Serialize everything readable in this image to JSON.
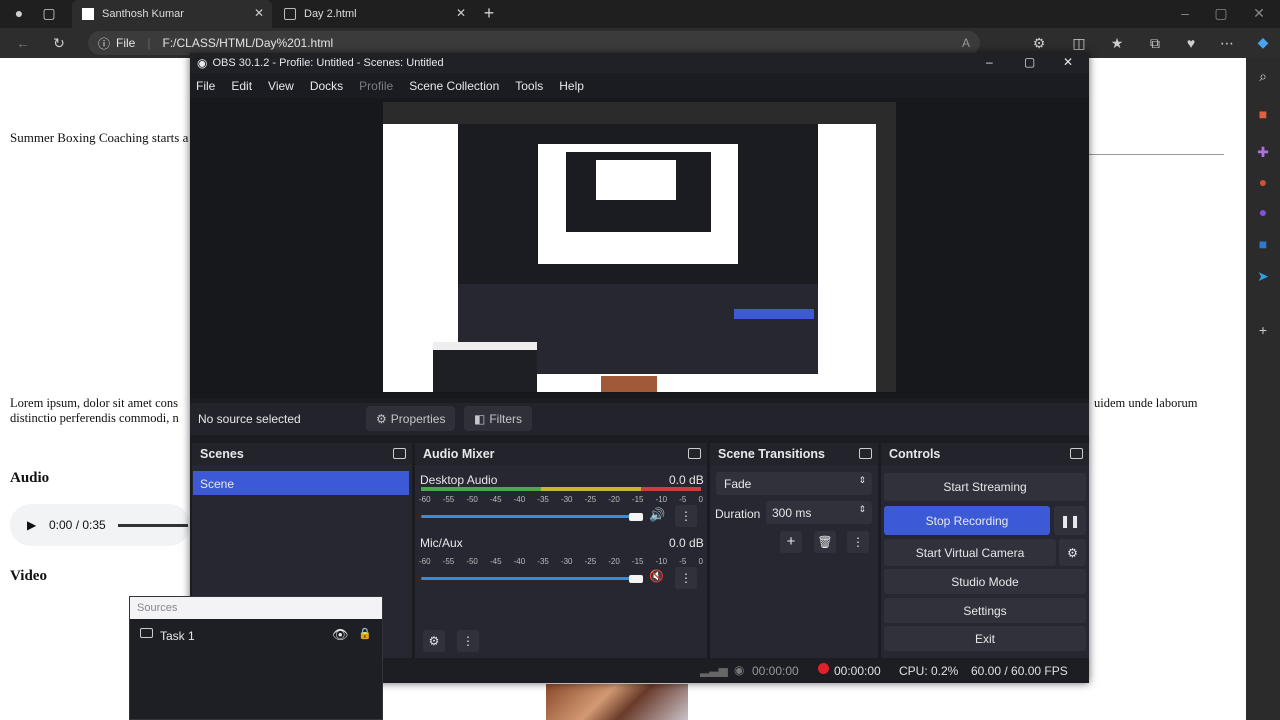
{
  "browser": {
    "tabs": [
      {
        "title": "Santhosh Kumar",
        "active": true
      },
      {
        "title": "Day 2.html",
        "active": false
      }
    ],
    "address": {
      "scheme_label": "File",
      "url": "F:/CLASS/HTML/Day%201.html"
    }
  },
  "webpage": {
    "headline": "Summer Boxing Coaching starts a",
    "lorem_left_1": "Lorem ipsum, dolor sit amet cons",
    "lorem_left_2": "distinctio perferendis commodi, n",
    "lorem_right": "uidem unde laborum",
    "audio_heading": "Audio",
    "audio_time": "0:00 / 0:35",
    "video_heading": "Video"
  },
  "obs": {
    "title": "OBS 30.1.2 - Profile: Untitled - Scenes: Untitled",
    "menu": [
      "File",
      "Edit",
      "View",
      "Docks",
      "Profile",
      "Scene Collection",
      "Tools",
      "Help"
    ],
    "menu_disabled": "Profile",
    "context_bar": {
      "no_source": "No source selected",
      "properties": "Properties",
      "filters": "Filters"
    },
    "scenes": {
      "title": "Scenes",
      "items": [
        "Scene"
      ]
    },
    "audio_mixer": {
      "title": "Audio Mixer",
      "channels": [
        {
          "name": "Desktop Audio",
          "level": "0.0 dB",
          "muted": false
        },
        {
          "name": "Mic/Aux",
          "level": "0.0 dB",
          "muted": true
        }
      ],
      "ticks": [
        "-60",
        "-55",
        "-50",
        "-45",
        "-40",
        "-35",
        "-30",
        "-25",
        "-20",
        "-15",
        "-10",
        "-5",
        "0"
      ]
    },
    "transitions": {
      "title": "Scene Transitions",
      "selected": "Fade",
      "duration_label": "Duration",
      "duration_value": "300 ms"
    },
    "controls": {
      "title": "Controls",
      "start_streaming": "Start Streaming",
      "stop_recording": "Stop Recording",
      "start_virtual_camera": "Start Virtual Camera",
      "studio_mode": "Studio Mode",
      "settings": "Settings",
      "exit": "Exit"
    },
    "status": {
      "stream_time": "00:00:00",
      "record_time": "00:00:00",
      "cpu": "CPU: 0.2%",
      "fps": "60.00 / 60.00 FPS"
    }
  },
  "sources": {
    "title": "Sources",
    "items": [
      {
        "name": "Task 1"
      }
    ]
  },
  "colors": {
    "obs_blue": "#3c5ad6",
    "record_red": "#e0202a",
    "meter_green": "#4aa84a",
    "meter_yellow": "#c8b43a",
    "meter_red": "#c8423a"
  }
}
